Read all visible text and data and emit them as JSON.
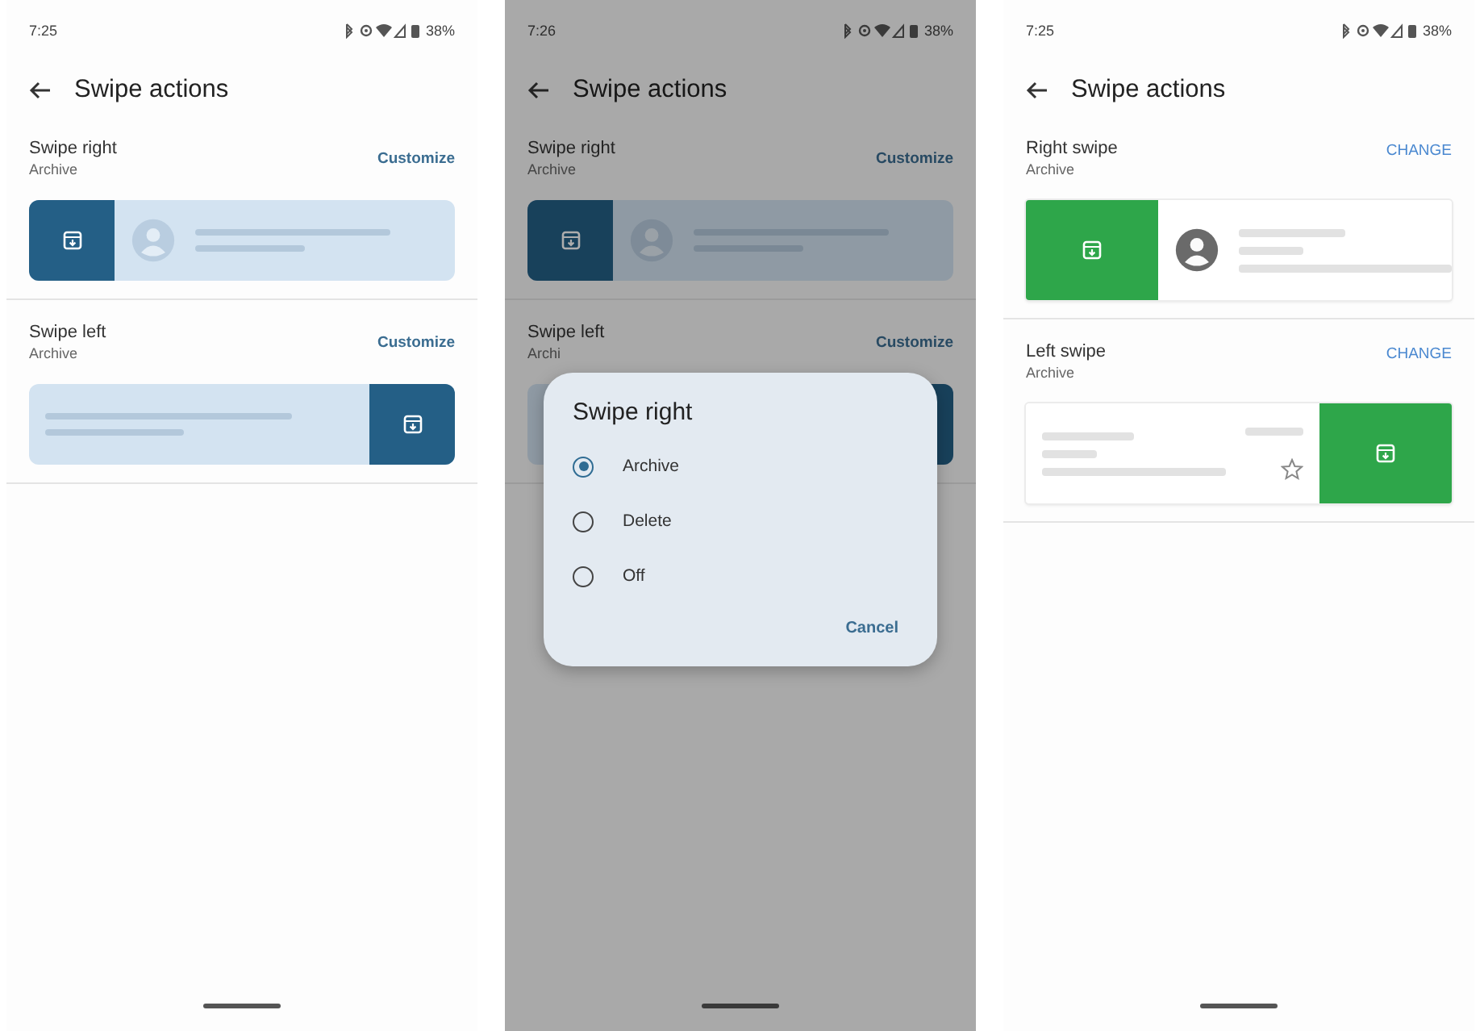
{
  "screens": [
    {
      "kind": "tonal",
      "dimmed": false,
      "status": {
        "time": "7:25",
        "battery": "38%"
      },
      "title": "Swipe actions",
      "sections": [
        {
          "label": "Swipe right",
          "value": "Archive",
          "action": "Customize",
          "kind": "right"
        },
        {
          "label": "Swipe left",
          "value": "Archive",
          "action": "Customize",
          "kind": "left"
        }
      ]
    },
    {
      "kind": "tonal",
      "dimmed": true,
      "status": {
        "time": "7:26",
        "battery": "38%"
      },
      "title": "Swipe actions",
      "sections": [
        {
          "label": "Swipe right",
          "value": "Archive",
          "action": "Customize",
          "kind": "right"
        },
        {
          "label": "Swipe left",
          "value": "Archi",
          "action": "Customize",
          "kind": "left"
        }
      ],
      "dialog": {
        "title": "Swipe right",
        "options": [
          {
            "label": "Archive",
            "selected": true
          },
          {
            "label": "Delete",
            "selected": false
          },
          {
            "label": "Off",
            "selected": false
          }
        ],
        "button": "Cancel"
      }
    },
    {
      "kind": "classic",
      "dimmed": false,
      "status": {
        "time": "7:25",
        "battery": "38%"
      },
      "title": "Swipe actions",
      "sections": [
        {
          "label": "Right swipe",
          "value": "Archive",
          "action": "CHANGE",
          "kind": "right"
        },
        {
          "label": "Left swipe",
          "value": "Archive",
          "action": "CHANGE",
          "kind": "left"
        }
      ]
    }
  ]
}
